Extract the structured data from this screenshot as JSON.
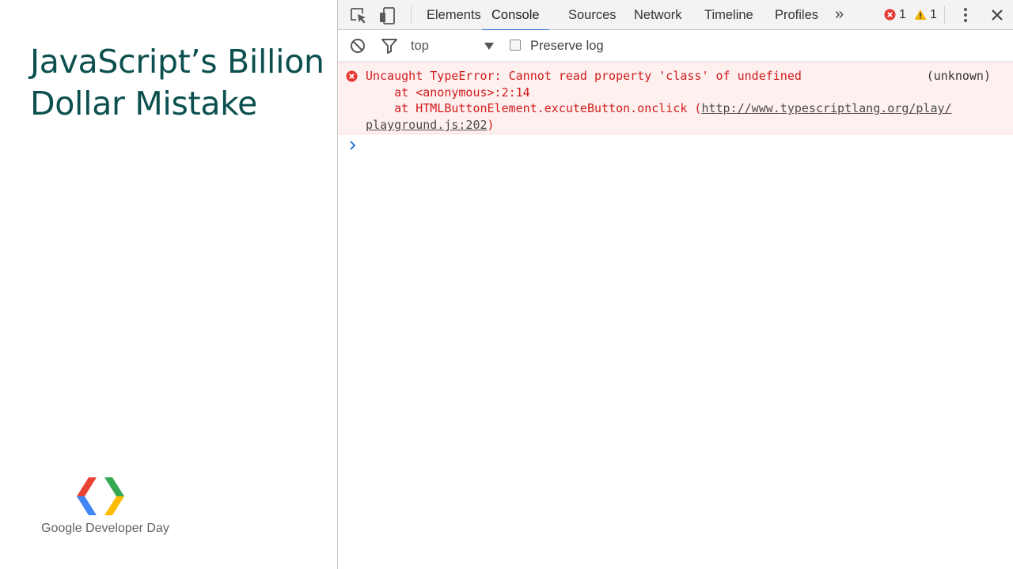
{
  "slide": {
    "title_line1": "JavaScript’s Billion",
    "title_line2": "Dollar Mistake",
    "brand_text": "Google Developer Day",
    "brand_colors": {
      "red": "#ea4335",
      "blue": "#4285f4",
      "green": "#34a853",
      "yellow": "#fbbc05"
    },
    "title_color": "#0b4f4e"
  },
  "devtools": {
    "toolbar": {
      "inspect_icon": "inspect-element-icon",
      "device_icon": "device-toolbar-icon",
      "tabs": [
        {
          "label": "Elements",
          "active": false
        },
        {
          "label": "Console",
          "active": true
        },
        {
          "label": "Sources",
          "active": false
        },
        {
          "label": "Network",
          "active": false
        },
        {
          "label": "Timeline",
          "active": false
        },
        {
          "label": "Profiles",
          "active": false
        }
      ],
      "more_tabs": "»",
      "error_count": "1",
      "warning_count": "1",
      "accent_color": "#3879d9"
    },
    "console_toolbar": {
      "context": "top",
      "preserve_log_label": "Preserve log",
      "preserve_log_checked": false
    },
    "messages": [
      {
        "level": "error",
        "text": "Uncaught TypeError: Cannot read property 'class' of undefined",
        "source": "(unknown)",
        "stack_line1": "    at <anonymous>:2:14",
        "stack_line2_prefix": "    at HTMLButtonElement.excuteButton.onclick (",
        "stack_link_part1": "http://www.typescriptlang.org/play/",
        "stack_link_part2": "playground.js:202",
        "stack_line3_suffix": ")",
        "color": "#d21b1b"
      }
    ],
    "prompt_symbol": "›"
  }
}
